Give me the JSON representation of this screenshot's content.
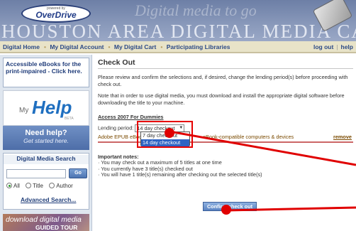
{
  "header": {
    "logo_powered_by": "powered by",
    "logo_name": "OverDrive",
    "site_title": "HOUSTON AREA DIGITAL MEDIA CATALOG",
    "script_overlay": "Digital media to go"
  },
  "nav": {
    "items": [
      "Digital Home",
      "My Digital Account",
      "My Digital Cart",
      "Participating Libraries"
    ],
    "logout": "log out",
    "help": "help"
  },
  "sidebar": {
    "access_text": "Accessible eBooks for the print-impaired - Click here.",
    "myhelp_my": "My",
    "myhelp_help": "Help",
    "myhelp_beta": "BETA",
    "needhelp_title": "Need help?",
    "needhelp_sub": "Get started here.",
    "search_title": "Digital Media Search",
    "search_value": "",
    "go_label": "Go",
    "radio_options": [
      "All",
      "Title",
      "Author"
    ],
    "radio_selected": "All",
    "advanced_search": "Advanced Search...",
    "guided_line1": "download digital media",
    "guided_line2": "GUIDED TOUR"
  },
  "main": {
    "title": "Check Out",
    "para1": "Please review and confirm the selections and, if desired, change the lending period(s) before proceeding with check out.",
    "para2": "Note that in order to use digital media, you must download and install the appropriate digital software before downloading the title to your machine.",
    "book_title": "Access 2007 For Dummies",
    "lending_label": "Lending period:",
    "lending_selected": "14 day checkout",
    "dropdown_options": [
      "7 day checkout",
      "14 day checkout"
    ],
    "format_left": "Adobe EPUB eBook",
    "format_right": "eBook-compatible computers & devices",
    "remove_label": "remove",
    "notes_title": "Important notes:",
    "notes": [
      "· You may check out a maximum of 5 titles at one time",
      "· You currently have 3 title(s) checked out",
      "· You will have 1 title(s) remaining after checking out the selected title(s)"
    ],
    "confirm_label": "Confirm check out"
  },
  "colors": {
    "annotation_red": "#e00000",
    "header_blue": "#6d7fa6",
    "link_blue": "#2c4a86"
  }
}
